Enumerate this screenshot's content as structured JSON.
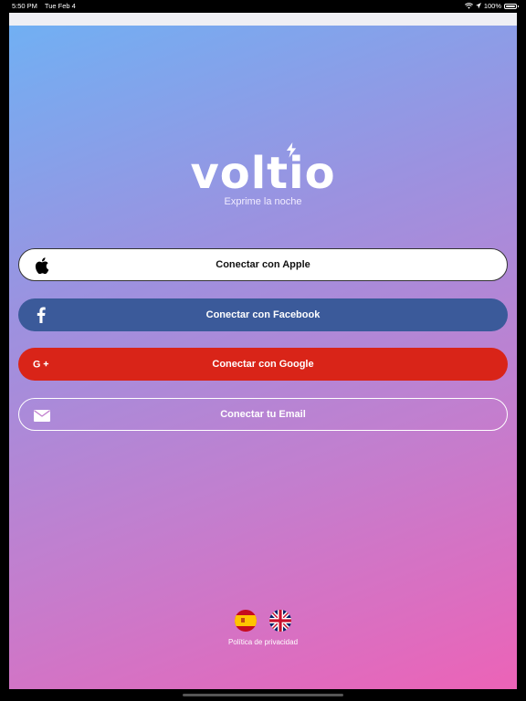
{
  "status_bar": {
    "time": "5:50 PM",
    "date": "Tue Feb 4",
    "battery": "100%",
    "icons": [
      "wifi-icon",
      "location-icon",
      "battery-icon"
    ]
  },
  "app": {
    "logo": "voltio",
    "tagline": "Exprime la noche"
  },
  "buttons": {
    "apple": {
      "label": "Conectar con Apple",
      "icon": "apple-icon"
    },
    "facebook": {
      "label": "Conectar con Facebook",
      "icon": "facebook-icon"
    },
    "google": {
      "label": "Conectar con Google",
      "icon": "google-plus-icon"
    },
    "email": {
      "label": "Conectar tu Email",
      "icon": "mail-icon"
    }
  },
  "footer": {
    "flags": [
      "spain-flag-icon",
      "uk-flag-icon"
    ],
    "privacy": "Política de privacidad"
  },
  "colors": {
    "facebook": "#3b5a9a",
    "google": "#d92418",
    "gradient_top": "#6fb1f4",
    "gradient_bottom": "#ec63b7"
  }
}
